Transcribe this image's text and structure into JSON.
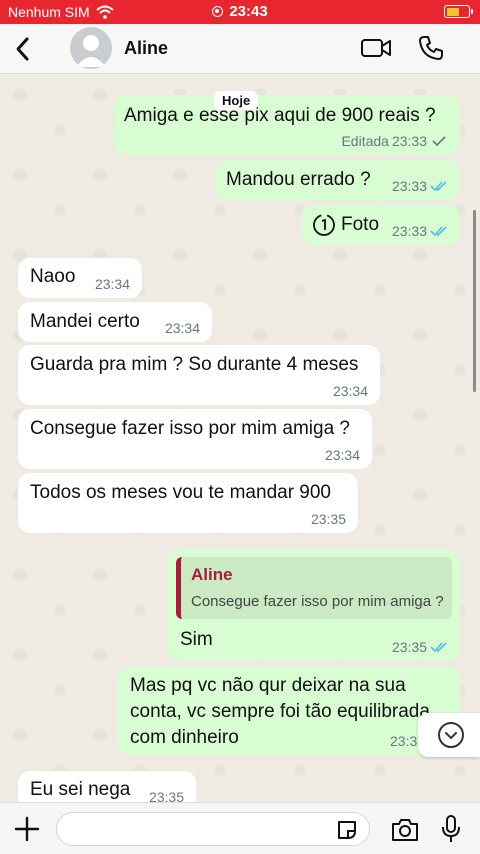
{
  "status_bar": {
    "carrier": "Nenhum SIM",
    "time": "23:43",
    "battery_level": 0.6,
    "color": "#e8262f"
  },
  "header": {
    "contact_name": "Aline",
    "icons": [
      "back-chevron-icon",
      "avatar-icon",
      "video-call-icon",
      "phone-icon"
    ]
  },
  "chat": {
    "day_label": "Hoje",
    "messages": [
      {
        "dir": "out",
        "text": "Amiga e esse  pix aqui de 900 reais ?",
        "edited": "Editada",
        "time": "23:33",
        "status": "delivered"
      },
      {
        "dir": "out",
        "text": "Mandou errado ?",
        "time": "23:33",
        "status": "read"
      },
      {
        "dir": "out",
        "text": "Foto",
        "time": "23:33",
        "status": "read",
        "type": "view-once-photo"
      },
      {
        "dir": "in",
        "text": "Naoo",
        "time": "23:34"
      },
      {
        "dir": "in",
        "text": "Mandei certo",
        "time": "23:34"
      },
      {
        "dir": "in",
        "text": "Guarda pra mim ? So durante 4 meses",
        "time": "23:34"
      },
      {
        "dir": "in",
        "text": "Consegue fazer isso por mim amiga ?",
        "time": "23:34"
      },
      {
        "dir": "in",
        "text": "Todos os meses vou te mandar 900",
        "time": "23:35"
      },
      {
        "dir": "out",
        "reply_author": "Aline",
        "reply_text": "Consegue fazer isso por mim amiga ?",
        "text": "Sim",
        "time": "23:35",
        "status": "read"
      },
      {
        "dir": "out",
        "lines": [
          "Mas pq vc não qur deixar na sua",
          "conta, vc sempre foi tão equilibrada",
          "com dinheiro"
        ],
        "time": "23:3"
      },
      {
        "dir": "in",
        "text": "Eu sei nega",
        "time": "23:35"
      }
    ]
  },
  "input_bar": {
    "placeholder": "",
    "icons": [
      "plus-icon",
      "sticker-icon",
      "camera-icon",
      "microphone-icon"
    ]
  },
  "colors": {
    "outgoing_bubble": "#d9fdd3",
    "incoming_bubble": "#ffffff",
    "read_tick": "#53bdeb",
    "reply_accent": "#a51d3b"
  }
}
